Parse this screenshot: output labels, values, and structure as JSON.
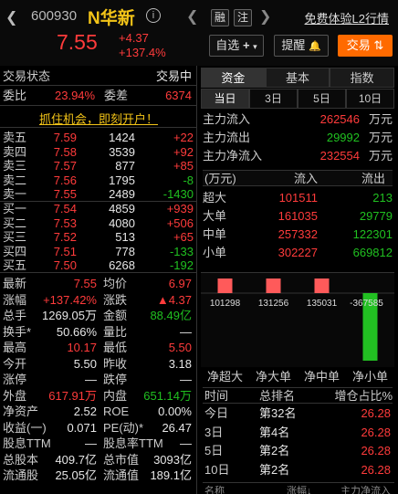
{
  "header": {
    "code": "600930",
    "name": "N华新",
    "info_icon": "i",
    "badge_rong": "融",
    "badge_zhu": "注",
    "l2_link": "免费体验L2行情",
    "price": "7.55",
    "change_abs": "+4.37",
    "change_pct": "+137.4%",
    "btn_watchlist": "自选",
    "btn_alert": "提醒",
    "btn_trade": "交易"
  },
  "status": {
    "label": "交易状态",
    "value": "交易中"
  },
  "ratio": {
    "weibi_label": "委比",
    "weibi_value": "23.94%",
    "weicha_label": "委差",
    "weicha_value": "6374"
  },
  "promo": "抓住机会，即刻开户！",
  "sells": [
    {
      "label": "卖五",
      "price": "7.59",
      "vol": "1424",
      "chg": "+22"
    },
    {
      "label": "卖四",
      "price": "7.58",
      "vol": "3539",
      "chg": "+92"
    },
    {
      "label": "卖三",
      "price": "7.57",
      "vol": "877",
      "chg": "+85"
    },
    {
      "label": "卖二",
      "price": "7.56",
      "vol": "1795",
      "chg": "-8"
    },
    {
      "label": "卖一",
      "price": "7.55",
      "vol": "2489",
      "chg": "-1430"
    }
  ],
  "buys": [
    {
      "label": "买一",
      "price": "7.54",
      "vol": "4859",
      "chg": "+939"
    },
    {
      "label": "买二",
      "price": "7.53",
      "vol": "4080",
      "chg": "+506"
    },
    {
      "label": "买三",
      "price": "7.52",
      "vol": "513",
      "chg": "+65"
    },
    {
      "label": "买四",
      "price": "7.51",
      "vol": "778",
      "chg": "-133"
    },
    {
      "label": "买五",
      "price": "7.50",
      "vol": "6268",
      "chg": "-192"
    }
  ],
  "stats": [
    {
      "l1": "最新",
      "v1": "7.55",
      "l2": "均价",
      "v2": "6.97"
    },
    {
      "l1": "涨幅",
      "v1": "+137.42%",
      "l2": "涨跌",
      "v2": "▲4.37"
    },
    {
      "l1": "总手",
      "v1": "1269.05万",
      "l2": "金额",
      "v2": "88.49亿"
    },
    {
      "l1": "换手*",
      "v1": "50.66%",
      "l2": "量比",
      "v2": "—"
    },
    {
      "l1": "最高",
      "v1": "10.17",
      "l2": "最低",
      "v2": "5.50"
    },
    {
      "l1": "今开",
      "v1": "5.50",
      "l2": "昨收",
      "v2": "3.18"
    },
    {
      "l1": "涨停",
      "v1": "—",
      "l2": "跌停",
      "v2": "—"
    },
    {
      "l1": "外盘",
      "v1": "617.91万",
      "l2": "内盘",
      "v2": "651.14万"
    },
    {
      "l1": "净资产",
      "v1": "2.52",
      "l2": "ROE",
      "v2": "0.00%"
    },
    {
      "l1": "收益(一)",
      "v1": "0.071",
      "l2": "PE(动)*",
      "v2": "26.47"
    },
    {
      "l1": "股息TTM",
      "v1": "—",
      "l2": "股息率TTM",
      "v2": "—"
    },
    {
      "l1": "总股本",
      "v1": "409.7亿",
      "l2": "总市值",
      "v2": "3093亿"
    },
    {
      "l1": "流通股",
      "v1": "25.05亿",
      "l2": "流通值",
      "v2": "189.1亿"
    }
  ],
  "right": {
    "tabs": [
      "资金",
      "基本",
      "指数"
    ],
    "subtabs": [
      "当日",
      "3日",
      "5日",
      "10日"
    ],
    "flows": [
      {
        "label": "主力流入",
        "value": "262546",
        "unit": "万元"
      },
      {
        "label": "主力流出",
        "value": "29992",
        "unit": "万元"
      },
      {
        "label": "主力净流入",
        "value": "232554",
        "unit": "万元"
      }
    ],
    "table_header": {
      "unit": "(万元)",
      "in": "流入",
      "out": "流出"
    },
    "table_rows": [
      {
        "label": "超大",
        "in": "101511",
        "out": "213"
      },
      {
        "label": "大单",
        "in": "161035",
        "out": "29779"
      },
      {
        "label": "中单",
        "in": "257332",
        "out": "122301"
      },
      {
        "label": "小单",
        "in": "302227",
        "out": "669812"
      }
    ],
    "bars": [
      {
        "label": "净超大",
        "value": 101298,
        "text": "101298"
      },
      {
        "label": "净大单",
        "value": 131256,
        "text": "131256"
      },
      {
        "label": "净中单",
        "value": 135031,
        "text": "135031"
      },
      {
        "label": "净小单",
        "value": -367585,
        "text": "-367585"
      }
    ],
    "rank_header": {
      "time": "时间",
      "rank": "总排名",
      "pct": "增仓占比%"
    },
    "rank_rows": [
      {
        "time": "今日",
        "rank": "第32名",
        "pct": "26.28"
      },
      {
        "time": "3日",
        "rank": "第4名",
        "pct": "26.28"
      },
      {
        "time": "5日",
        "rank": "第2名",
        "pct": "26.28"
      },
      {
        "time": "10日",
        "rank": "第2名",
        "pct": "26.28"
      }
    ],
    "footer": {
      "a": "名称",
      "b": "涨幅↓",
      "c": "主力净流入"
    }
  }
}
